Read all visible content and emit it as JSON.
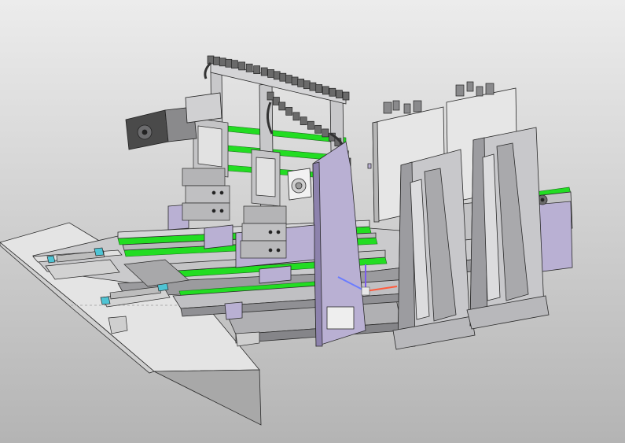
{
  "viewport": {
    "background_top": "#ececec",
    "background_bottom": "#b4b4b4"
  },
  "colors": {
    "frame_purple": "#b9b0d3",
    "frame_purple_dark": "#8d82ad",
    "frame_purple_light": "#d6cfe8",
    "steel": "#bcbcbe",
    "steel_dark": "#7c7c80",
    "steel_light": "#dcdcde",
    "rail_green": "#22dd22",
    "outline": "#2a2a2a",
    "plate": "#dedede",
    "motor": "#4a4a4a",
    "cable_chain": "#6a6a6a",
    "connector_cyan": "#4fc4d4"
  },
  "triad": {
    "x_color": "#ff5a3c",
    "y_color": "#6a7cff",
    "z_color": "#7a5af0",
    "label": ""
  }
}
